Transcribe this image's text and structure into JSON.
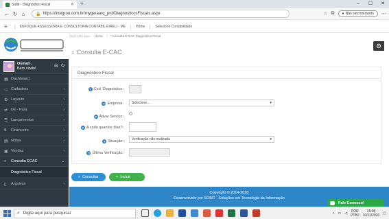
{
  "browser": {
    "tab_title": "Sobit - Diagnóstico Fiscal",
    "new_tab": "+",
    "url": "https://integrou.com.br/mygeraarq_prd/DiagnosticosFiscais.aspx",
    "sync_label": "Não sincronizando"
  },
  "topnav": {
    "company": "ENFOQUE ASSESSORIA E CONSULTORIA CONTABIL EIRELI - ME",
    "home": "Home",
    "select": "Selecione Contabilidade"
  },
  "user": {
    "name": "Osmair ,",
    "greeting": "Bem vindo!"
  },
  "sidebar": {
    "items": [
      {
        "label": "Dashboard"
      },
      {
        "label": "Cadastros"
      },
      {
        "label": "Layouts"
      },
      {
        "label": "De - Para"
      },
      {
        "label": "Lançamentos"
      },
      {
        "label": "Financeiro"
      },
      {
        "label": "Notas"
      },
      {
        "label": "Vendas"
      },
      {
        "label": "Consulta ECAC"
      }
    ],
    "subitem": "Diagnóstico Fiscal",
    "more": "Arquivos"
  },
  "breadcrumb": {
    "here": "Você está aqui:",
    "home": "Home",
    "current": "Consulta E-CAC Diagnóstico Fiscal"
  },
  "page_title": "Consulta E-CAC",
  "panel": {
    "header": "Diagnóstico Fiscal",
    "labels": {
      "cod": "Cod. Diagnóstico:",
      "empresa": "Empresa:",
      "ativar": "Ativar Serviço:",
      "dias": "A cada quantos dias?:",
      "situacao": "Situação:",
      "ultima": "Última Verificação:"
    },
    "empresa_value": "Selecione...",
    "situacao_value": "Verificação não realizada"
  },
  "buttons": {
    "consultar": "Consultar",
    "incluir": "Incluir"
  },
  "footer": {
    "line1": "Copyright © 2014-2020",
    "line2": "Desenvolvido por SOBIT - Soluções em Tecnologia da Informação"
  },
  "chat": "Fale Conosco!",
  "taskbar": {
    "search": "Digite aqui para pesquisar",
    "lang1": "POR",
    "lang2": "PTB2",
    "time": "15:08",
    "date": "10/11/2020"
  },
  "colors": {
    "sidebar": "#2f3941",
    "footer": "#2e86c9",
    "consultar": "#2d8fd5",
    "incluir": "#3fb24a",
    "chat": "#29a846"
  }
}
